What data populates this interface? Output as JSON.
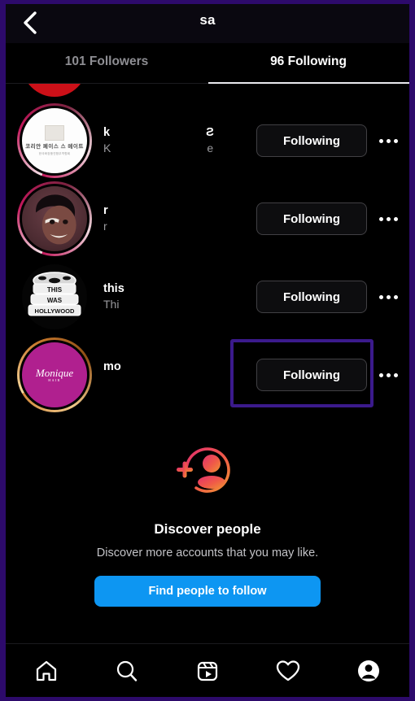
{
  "theme": {
    "frame_border": "#2d0a6b",
    "background": "#000000",
    "accent_blue": "#0d96f2",
    "highlight_box": "#3b1a8c",
    "muted_text": "#8e8e93"
  },
  "header": {
    "back_icon": "chevron-left-icon",
    "title": "sa"
  },
  "tabs": [
    {
      "label": "101 Followers",
      "active": false
    },
    {
      "label": "96 Following",
      "active": true
    }
  ],
  "list": {
    "rows": [
      {
        "name": "",
        "fullname": "",
        "avatar_kind": "red",
        "ring": "none",
        "partial": true,
        "button": "",
        "more": "",
        "highlighted": false
      },
      {
        "name": "k",
        "fullname": "K",
        "name_tail": "Ƨ",
        "fullname_tail": "e",
        "avatar_kind": "korean",
        "avatar_text_1": "코리안 페이스 스 메이트",
        "avatar_text_2": "한국화장품연합무역협회",
        "ring": "pink",
        "partial": false,
        "button": "Following",
        "more": "more-options-icon",
        "highlighted": false
      },
      {
        "name": "r",
        "fullname": "r",
        "name_tail": "",
        "fullname_tail": "",
        "avatar_kind": "maroon",
        "ring": "pink",
        "partial": false,
        "button": "Following",
        "more": "more-options-icon",
        "highlighted": false
      },
      {
        "name": "this",
        "fullname": "Thi",
        "name_tail": "",
        "fullname_tail": "",
        "avatar_kind": "filmreel",
        "avatar_text_1": "THIS",
        "avatar_text_2": "WAS",
        "avatar_text_3": "HOLLYWOOD",
        "ring": "none",
        "partial": false,
        "button": "Following",
        "more": "more-options-icon",
        "highlighted": false
      },
      {
        "name": "mo",
        "fullname": "",
        "name_tail": "",
        "fullname_tail": "",
        "avatar_kind": "magenta",
        "avatar_text_1": "Monique",
        "avatar_text_2": "HAIR",
        "ring": "gold",
        "partial": false,
        "button": "Following",
        "more": "more-options-icon",
        "highlighted": true
      }
    ]
  },
  "discover": {
    "icon": "add-person-icon",
    "title": "Discover people",
    "subtitle": "Discover more accounts that you may like.",
    "button_label": "Find people to follow"
  },
  "bottom_nav": [
    {
      "icon": "home-icon",
      "label": "Home"
    },
    {
      "icon": "search-icon",
      "label": "Search"
    },
    {
      "icon": "reels-icon",
      "label": "Reels"
    },
    {
      "icon": "heart-icon",
      "label": "Activity"
    },
    {
      "icon": "profile-icon",
      "label": "Profile"
    }
  ]
}
